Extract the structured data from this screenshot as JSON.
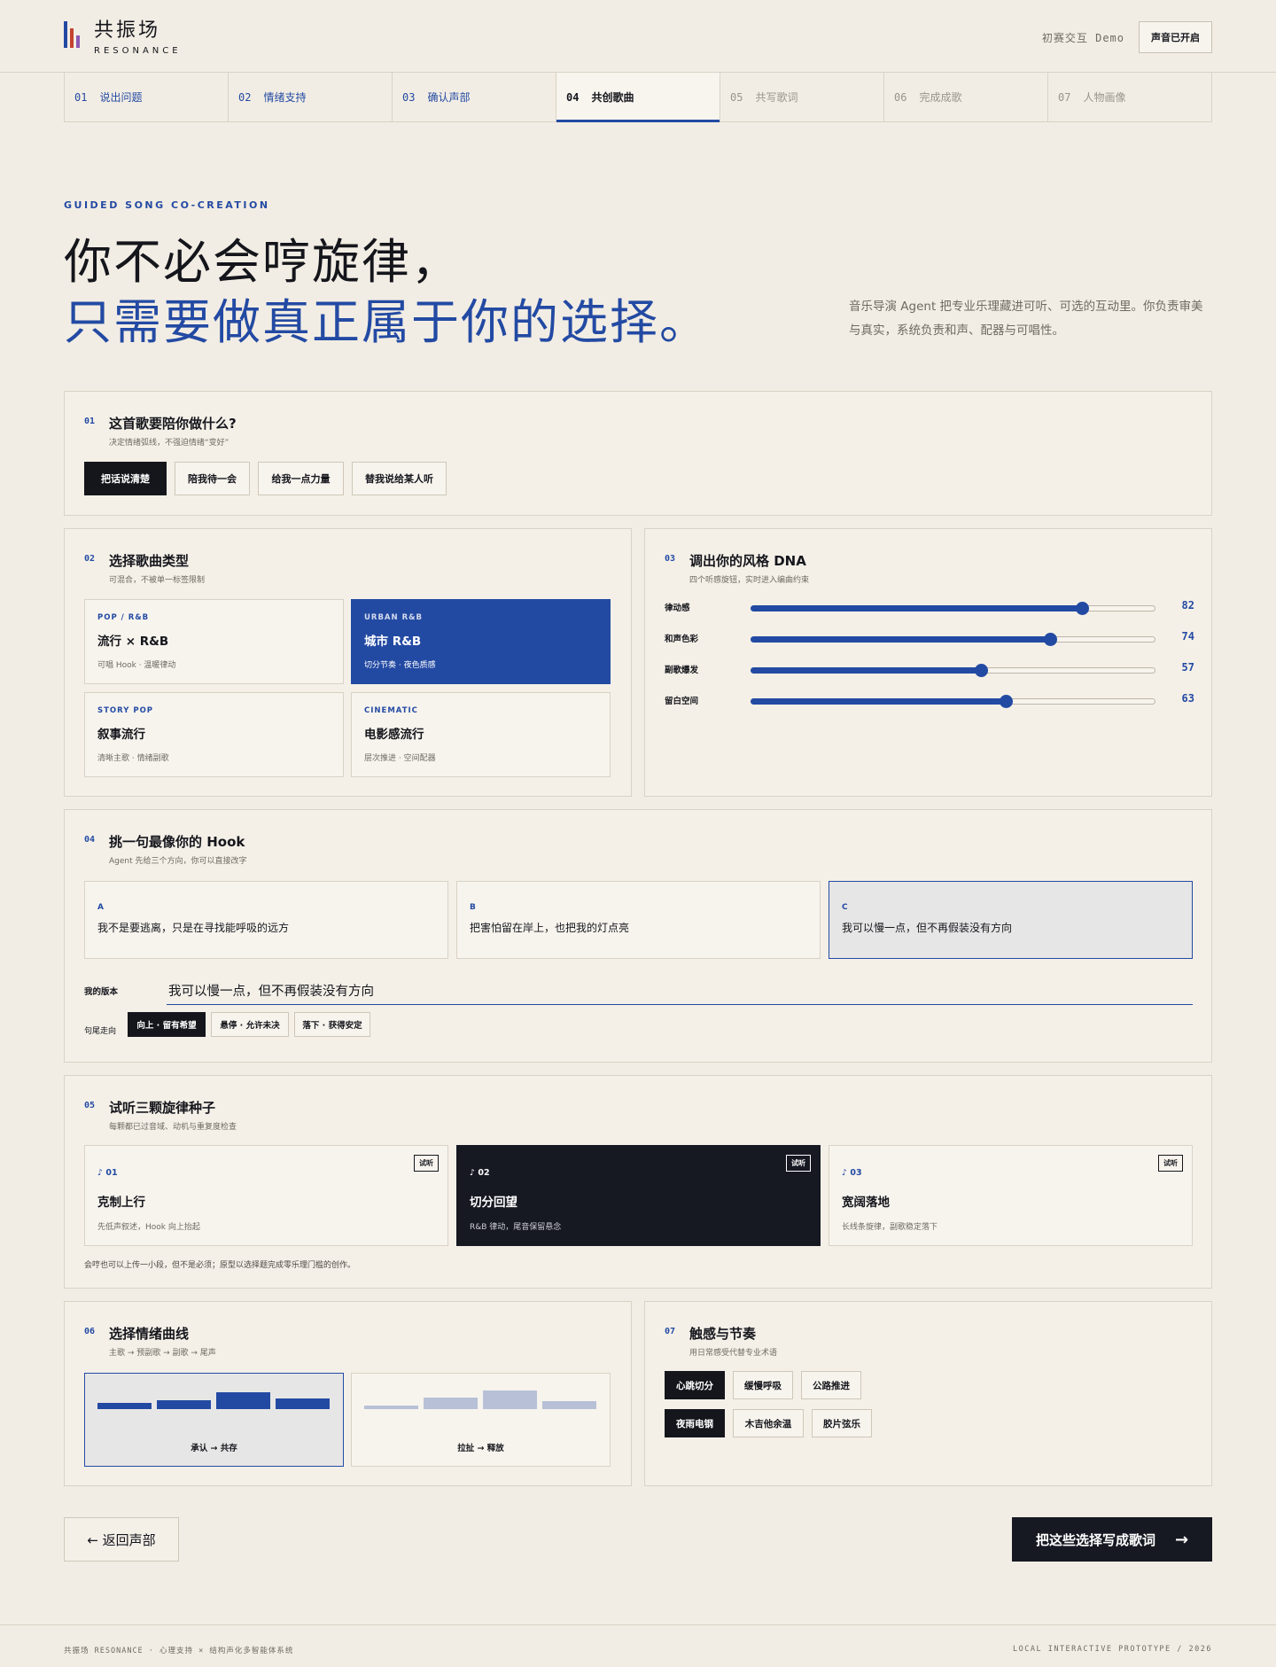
{
  "brand": {
    "name_cn": "共振场",
    "name_en": "RESONANCE",
    "bar_colors": [
      "#234aa3",
      "#c4432f",
      "#8b57b3"
    ]
  },
  "header": {
    "demo_label": "初赛交互 Demo",
    "sound_button": "声音已开启"
  },
  "steps": [
    {
      "num": "01",
      "label": "说出问题",
      "state": "done"
    },
    {
      "num": "02",
      "label": "情绪支持",
      "state": "done"
    },
    {
      "num": "03",
      "label": "确认声部",
      "state": "done"
    },
    {
      "num": "04",
      "label": "共创歌曲",
      "state": "active"
    },
    {
      "num": "05",
      "label": "共写歌词",
      "state": "todo"
    },
    {
      "num": "06",
      "label": "完成成歌",
      "state": "todo"
    },
    {
      "num": "07",
      "label": "人物画像",
      "state": "todo"
    }
  ],
  "hero": {
    "eyebrow": "GUIDED SONG CO-CREATION",
    "line1": "你不必会哼旋律，",
    "line2": "只需要做真正属于你的选择。",
    "description": "音乐导演 Agent 把专业乐理藏进可听、可选的互动里。你负责审美与真实，系统负责和声、配器与可唱性。"
  },
  "purpose": {
    "no": "01",
    "title": "这首歌要陪你做什么?",
    "subtitle": "决定情绪弧线，不强迫情绪“变好”",
    "options": [
      "把话说清楚",
      "陪我待一会",
      "给我一点力量",
      "替我说给某人听"
    ],
    "selected": 0
  },
  "genre": {
    "no": "02",
    "title": "选择歌曲类型",
    "subtitle": "可混合，不被单一标签限制",
    "options": [
      {
        "en": "POP / R&B",
        "cn": "流行 × R&B",
        "desc": "可唱 Hook · 温暖律动"
      },
      {
        "en": "URBAN R&B",
        "cn": "城市 R&B",
        "desc": "切分节奏 · 夜色质感"
      },
      {
        "en": "STORY POP",
        "cn": "叙事流行",
        "desc": "清晰主歌 · 情绪副歌"
      },
      {
        "en": "CINEMATIC",
        "cn": "电影感流行",
        "desc": "层次推进 · 空间配器"
      }
    ],
    "selected": 1
  },
  "dna": {
    "no": "03",
    "title": "调出你的风格 DNA",
    "subtitle": "四个听感旋钮，实时进入编曲约束",
    "sliders": [
      {
        "label": "律动感",
        "value": 82
      },
      {
        "label": "和声色彩",
        "value": 74
      },
      {
        "label": "副歌爆发",
        "value": 57
      },
      {
        "label": "留白空间",
        "value": 63
      }
    ]
  },
  "hook": {
    "no": "04",
    "title": "挑一句最像你的 Hook",
    "subtitle": "Agent 先给三个方向，你可以直接改字",
    "options": [
      {
        "tag": "A",
        "text": "我不是要逃离，只是在寻找能呼吸的远方"
      },
      {
        "tag": "B",
        "text": "把害怕留在岸上，也把我的灯点亮"
      },
      {
        "tag": "C",
        "text": "我可以慢一点，但不再假装没有方向"
      }
    ],
    "selected": 2,
    "my_version_label": "我的版本",
    "my_version_value": "我可以慢一点，但不再假装没有方向",
    "ending_label": "句尾走向",
    "endings": [
      "向上 · 留有希望",
      "悬停 · 允许未决",
      "落下 · 获得安定"
    ],
    "ending_selected": 0
  },
  "seeds": {
    "no": "05",
    "title": "试听三颗旋律种子",
    "subtitle": "每颗都已过音域、动机与重复度检查",
    "items": [
      {
        "no": "♪ 01",
        "title": "克制上行",
        "desc": "先低声叙述，Hook 向上抬起",
        "play": "试听"
      },
      {
        "no": "♪ 02",
        "title": "切分回望",
        "desc": "R&B 律动，尾音保留悬念",
        "play": "试听"
      },
      {
        "no": "♪ 03",
        "title": "宽阔落地",
        "desc": "长线条旋律，副歌稳定落下",
        "play": "试听"
      }
    ],
    "selected": 1,
    "note": "会哼也可以上传一小段，但不是必须；原型以选择题完成零乐理门槛的创作。"
  },
  "curve": {
    "no": "06",
    "title": "选择情绪曲线",
    "subtitle": "主歌 → 预副歌 → 副歌 → 尾声",
    "options": [
      {
        "label": "承认 → 共存",
        "levels": [
          0.3,
          0.45,
          0.85,
          0.55
        ]
      },
      {
        "label": "拉扯 → 释放",
        "levels": [
          0.2,
          0.6,
          0.95,
          0.4
        ]
      }
    ],
    "selected": 0
  },
  "texture": {
    "no": "07",
    "title": "触感与节奏",
    "subtitle": "用日常感受代替专业术语",
    "row1": [
      "心跳切分",
      "缓慢呼吸",
      "公路推进"
    ],
    "row2": [
      "夜雨电钢",
      "木吉他余温",
      "胶片弦乐"
    ],
    "selected_row1": 0,
    "selected_row2": 0
  },
  "actions": {
    "back": "← 返回声部",
    "next": "把这些选择写成歌词",
    "next_arrow": "→"
  },
  "footer": {
    "left": "共振场 RESONANCE · 心理支持 × 结构声化多智能体系统",
    "right": "LOCAL INTERACTIVE PROTOTYPE / 2026"
  }
}
